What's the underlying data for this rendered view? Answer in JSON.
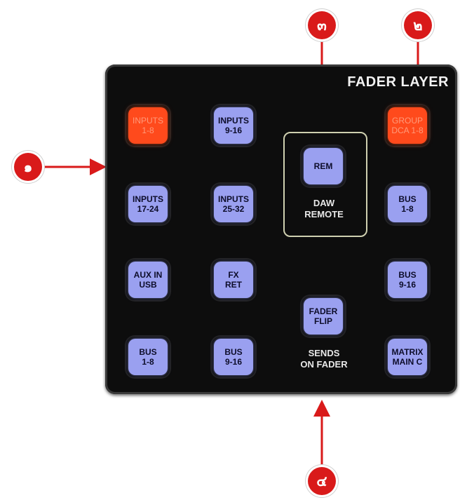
{
  "panel": {
    "title": "FADER LAYER",
    "buttons": [
      {
        "line1": "INPUTS",
        "line2": "1-8",
        "color": "#ff4a1c"
      },
      {
        "line1": "INPUTS",
        "line2": "9-16",
        "color": "#9aa0f0"
      },
      {
        "line1": "INPUTS",
        "line2": "17-24",
        "color": "#9aa0f0"
      },
      {
        "line1": "INPUTS",
        "line2": "25-32",
        "color": "#9aa0f0"
      },
      {
        "line1": "AUX IN",
        "line2": "USB",
        "color": "#9aa0f0"
      },
      {
        "line1": "FX",
        "line2": "RET",
        "color": "#9aa0f0"
      },
      {
        "line1": "BUS",
        "line2": "1-8",
        "color": "#9aa0f0"
      },
      {
        "line1": "BUS",
        "line2": "9-16",
        "color": "#9aa0f0"
      },
      {
        "line1": "REM",
        "line2": "",
        "color": "#9aa0f0"
      },
      {
        "line1": "FADER",
        "line2": "FLIP",
        "color": "#9aa0f0"
      },
      {
        "line1": "GROUP",
        "line2": "DCA 1-8",
        "color": "#ff4a1c"
      },
      {
        "line1": "BUS",
        "line2": "1-8",
        "color": "#9aa0f0"
      },
      {
        "line1": "BUS",
        "line2": "9-16",
        "color": "#9aa0f0"
      },
      {
        "line1": "MATRIX",
        "line2": "MAIN C",
        "color": "#9aa0f0"
      }
    ],
    "daw_remote": {
      "line1": "DAW",
      "line2": "REMOTE"
    },
    "sends_on_fader": {
      "line1": "SENDS",
      "line2": "ON FADER"
    }
  },
  "markers": [
    {
      "label": "๑"
    },
    {
      "label": "๒"
    },
    {
      "label": "๓"
    },
    {
      "label": "๔"
    }
  ]
}
